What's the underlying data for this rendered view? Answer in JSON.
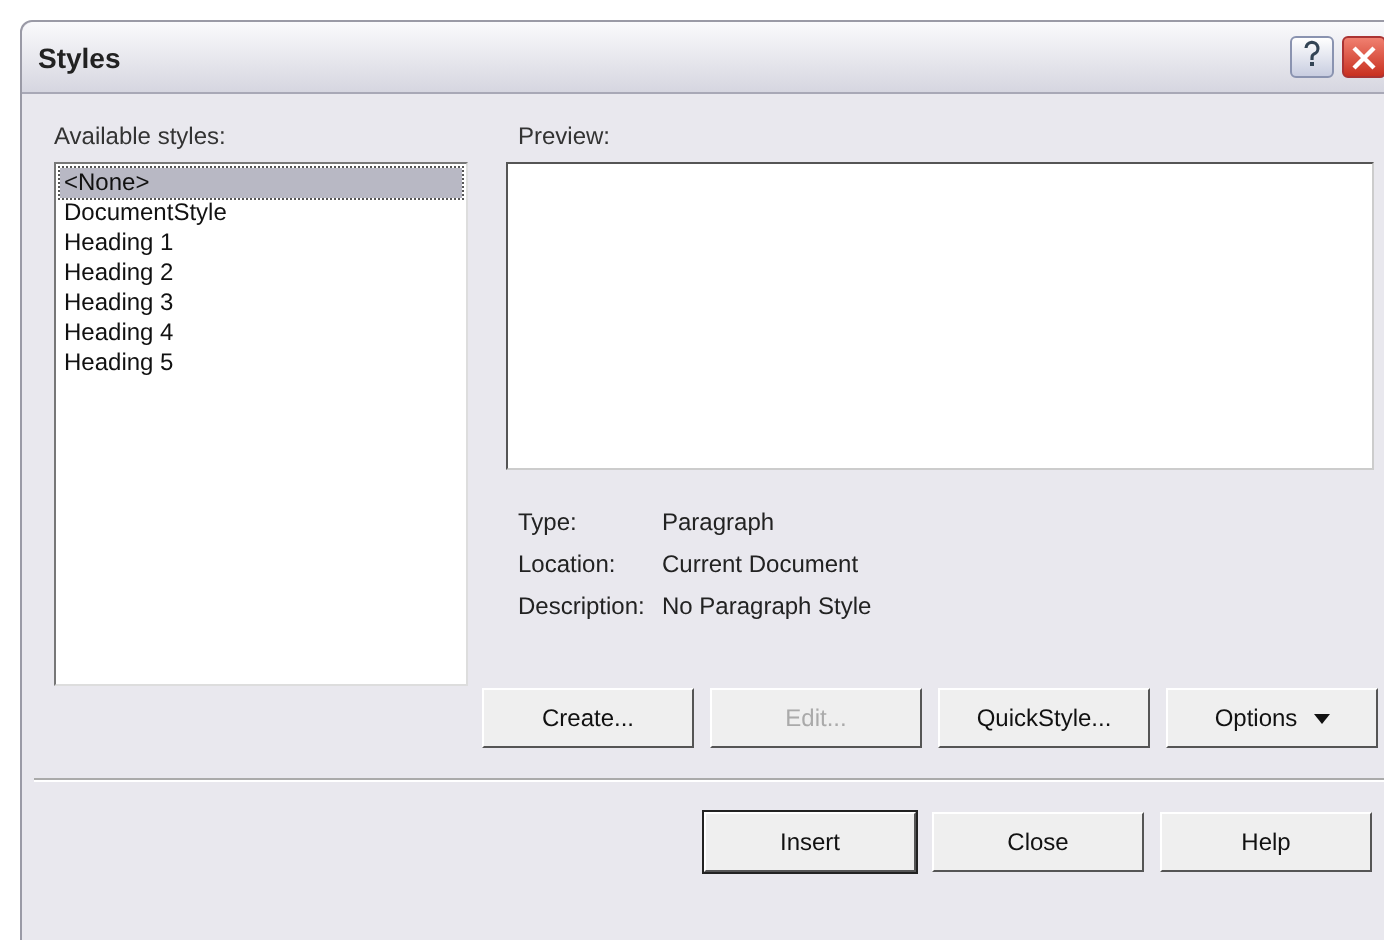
{
  "window": {
    "title": "Styles"
  },
  "styles_list": {
    "label": "Available styles:",
    "items": [
      {
        "label": "<None>",
        "selected": true
      },
      {
        "label": "DocumentStyle",
        "selected": false
      },
      {
        "label": "Heading 1",
        "selected": false
      },
      {
        "label": "Heading 2",
        "selected": false
      },
      {
        "label": "Heading 3",
        "selected": false
      },
      {
        "label": "Heading 4",
        "selected": false
      },
      {
        "label": "Heading 5",
        "selected": false
      }
    ]
  },
  "preview": {
    "label": "Preview:"
  },
  "details": [
    {
      "label": "Type:",
      "value": "Paragraph"
    },
    {
      "label": "Location:",
      "value": "Current Document"
    },
    {
      "label": "Description:",
      "value": "No Paragraph Style"
    }
  ],
  "action_buttons": [
    {
      "label": "Create...",
      "disabled": false,
      "kind": "plain"
    },
    {
      "label": "Edit...",
      "disabled": true,
      "kind": "plain"
    },
    {
      "label": "QuickStyle...",
      "disabled": false,
      "kind": "plain"
    },
    {
      "label": "Options",
      "disabled": false,
      "kind": "menu"
    }
  ],
  "dialog_buttons": [
    {
      "label": "Insert",
      "default": true
    },
    {
      "label": "Close",
      "default": false
    },
    {
      "label": "Help",
      "default": false
    }
  ]
}
